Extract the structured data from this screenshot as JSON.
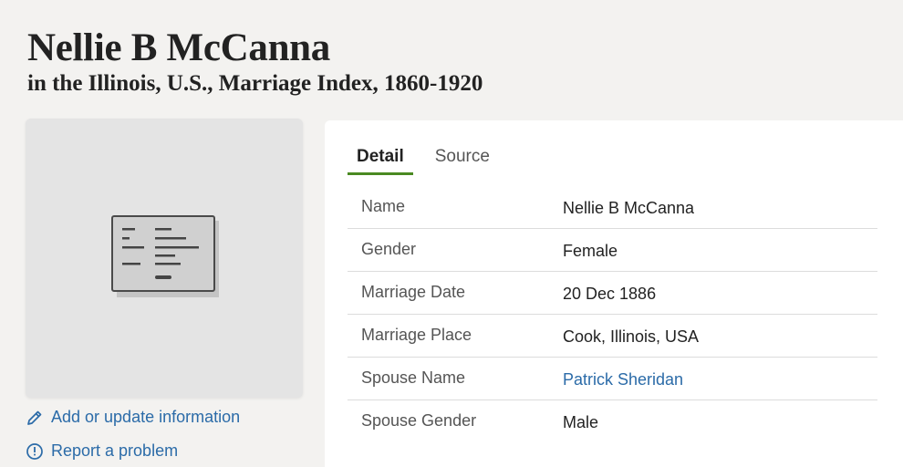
{
  "header": {
    "title": "Nellie B McCanna",
    "subtitle": "in the Illinois, U.S., Marriage Index, 1860-1920"
  },
  "image_panel": {
    "icon": "record-document-icon"
  },
  "side_links": {
    "add": {
      "label": "Add or update information",
      "icon": "pencil-icon"
    },
    "report": {
      "label": "Report a problem",
      "icon": "info-circle-icon"
    }
  },
  "tabs": [
    {
      "label": "Detail",
      "active": true
    },
    {
      "label": "Source",
      "active": false
    }
  ],
  "details": [
    {
      "label": "Name",
      "value": "Nellie B McCanna"
    },
    {
      "label": "Gender",
      "value": "Female"
    },
    {
      "label": "Marriage Date",
      "value": "20 Dec 1886"
    },
    {
      "label": "Marriage Place",
      "value": "Cook, Illinois, USA"
    },
    {
      "label": "Spouse Name",
      "value": "Patrick Sheridan",
      "is_link": true
    },
    {
      "label": "Spouse Gender",
      "value": "Male"
    }
  ],
  "colors": {
    "page_background": "#f3f2f0",
    "link": "#2b6ba8",
    "active_tab_underline": "#4a8a22"
  }
}
